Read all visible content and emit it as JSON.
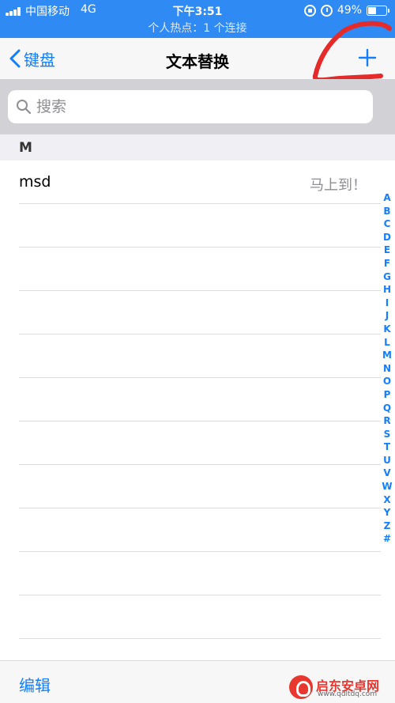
{
  "status_bar": {
    "carrier": "中国移动",
    "network": "4G",
    "time": "下午3:51",
    "battery_percent": "49%",
    "battery_level": 0.49,
    "hotspot": "个人热点：1 个连接"
  },
  "nav": {
    "back_label": "键盘",
    "title": "文本替换"
  },
  "search": {
    "placeholder": "搜索"
  },
  "sections": [
    {
      "letter": "M",
      "rows": [
        {
          "shortcut": "msd",
          "phrase": "马上到！"
        }
      ]
    }
  ],
  "index_letters": [
    "A",
    "B",
    "C",
    "D",
    "E",
    "F",
    "G",
    "H",
    "I",
    "J",
    "K",
    "L",
    "M",
    "N",
    "O",
    "P",
    "Q",
    "R",
    "S",
    "T",
    "U",
    "V",
    "W",
    "X",
    "Y",
    "Z",
    "#"
  ],
  "toolbar": {
    "edit_label": "编辑"
  },
  "watermark": {
    "name": "启东安卓网",
    "url": "www.qdltdq.com"
  },
  "colors": {
    "status_bar": "#2f8af4",
    "accent": "#147efb",
    "annotation": "#e52a2a"
  }
}
